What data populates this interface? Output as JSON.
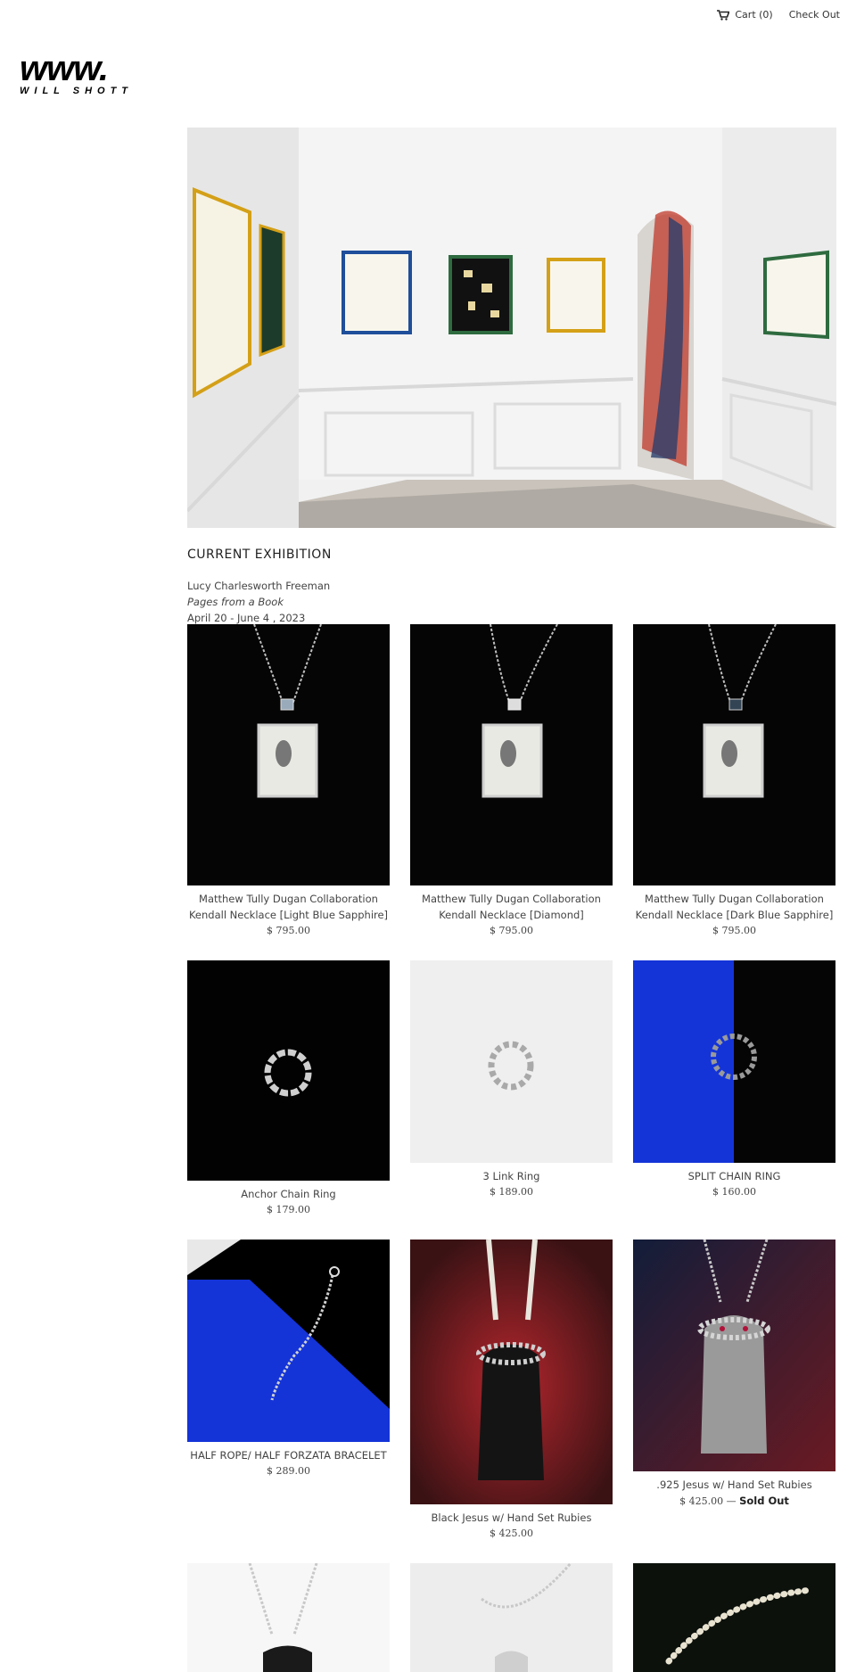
{
  "nav": {
    "cart_label": "Cart (0)",
    "checkout_label": "Check Out"
  },
  "brand": {
    "logo_main": "www.",
    "logo_sub": "WILL SHOTT"
  },
  "exhibition": {
    "title": "CURRENT EXHIBITION",
    "artist": "Lucy Charlesworth Freeman",
    "show": "Pages from a Book",
    "dates": "April 20 - June 4 , 2023"
  },
  "products": [
    {
      "line1": "Matthew Tully Dugan Collaboration",
      "line2": "Kendall Necklace [Light Blue Sapphire]",
      "price": "$ 795.00"
    },
    {
      "line1": "Matthew Tully Dugan Collaboration",
      "line2": "Kendall Necklace [Diamond]",
      "price": "$ 795.00"
    },
    {
      "line1": "Matthew Tully Dugan Collaboration",
      "line2": "Kendall Necklace [Dark Blue Sapphire]",
      "price": "$ 795.00"
    },
    {
      "line1": "Anchor Chain Ring",
      "price": "$ 179.00"
    },
    {
      "line1": "3 Link Ring",
      "price": "$ 189.00"
    },
    {
      "line1": "SPLIT CHAIN RING",
      "price": "$ 160.00"
    },
    {
      "line1": "HALF ROPE/ HALF FORZATA BRACELET",
      "price": "$ 289.00"
    },
    {
      "line1": "Black Jesus w/ Hand Set Rubies",
      "price": "$ 425.00"
    },
    {
      "line1": ".925 Jesus w/ Hand Set Rubies",
      "price": "$ 425.00",
      "status": "Sold Out"
    }
  ],
  "colors": {
    "accent_blue": "#1434d8",
    "dark_red": "#7a1c22",
    "black": "#000000"
  }
}
